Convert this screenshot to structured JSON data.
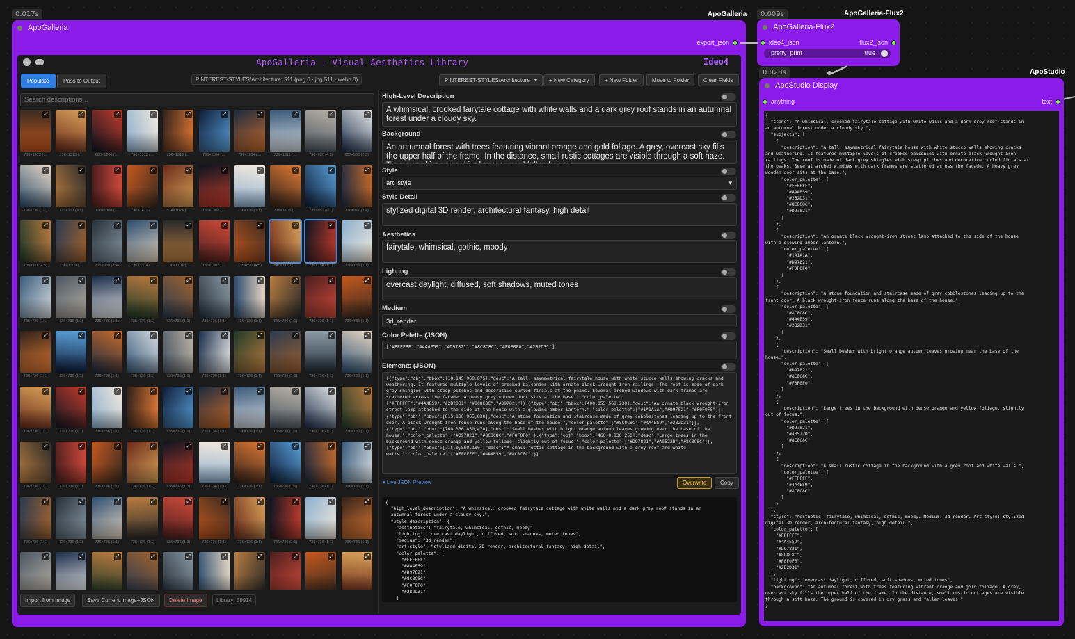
{
  "timings": {
    "galleria": "0.017s",
    "flux2": "0.009s",
    "studio": "0.023s"
  },
  "galleria": {
    "node_title": "ApoGalleria",
    "top_title": "ApoGalleria",
    "output_port": "export_json",
    "banner_title": "ApoGalleria - Visual Aesthetics Library",
    "banner_right": "Ideo4",
    "toolbar": {
      "populate": "Populate",
      "pass": "Pass to Output",
      "status": "PINTEREST-STYLES/Architecture: 511 (png 0 · jpg 511 · webp 0)",
      "folder_select": "PINTEREST-STYLES/Architecture",
      "new_category": "+ New Category",
      "new_folder": "+ New Folder",
      "move": "Move to Folder",
      "clear": "Clear Fields"
    },
    "search_placeholder": "Search descriptions...",
    "footer": {
      "import": "Import from Image",
      "save": "Save Current Image+JSON",
      "delete": "Delete Image",
      "library": "Library: 59914"
    },
    "captions": [
      [
        "736×1472 (…",
        "736×1313 (…",
        "600×1200 (…",
        "736×1312 (…",
        "736×1313 (…",
        "736×1104 (…",
        "736×1104 (…",
        "736×1311 (…",
        "736×920 (4:5)",
        "657×986 (2:3)"
      ],
      [
        "736×736 (1:1)",
        "735×917 (4:5)",
        "736×1308 (…",
        "736×1472 (…",
        "574×1024 (…",
        "736×1308 (…",
        "736×736 (1:1)",
        "736×1308 (…",
        "735×857 (6:7)",
        "736×977 (3:4)"
      ],
      [
        "736×911 (4:5)",
        "736×1309 (…",
        "715×988 (3:4)",
        "736×1314 (…",
        "736×1104 (…",
        "736×1307 (…",
        "735×896 (4:5)",
        "840×1120 (…",
        "736×754 (1:1)",
        "736×736 (1:1)"
      ],
      [
        "736×736 (1:1)",
        "736×736 (1:1)",
        "736×736 (1:1)",
        "736×736 (1:1)",
        "736×736 (1:1)",
        "736×736 (1:1)",
        "736×736 (1:1)",
        "736×736 (1:1)",
        "736×736 (1:1)",
        "736×736 (1:1)"
      ],
      [
        "736×736 (1:1)",
        "736×736 (1:1)",
        "736×736 (1:1)",
        "736×736 (1:1)",
        "736×736 (1:1)",
        "736×736 (1:1)",
        "736×736 (1:1)",
        "736×736 (1:1)",
        "736×736 (1:1)",
        "736×736 (1:1)"
      ],
      [
        "736×736 (1:1)",
        "736×736 (1:1)",
        "736×736 (1:1)",
        "736×736 (1:1)",
        "736×736 (1:1)",
        "736×736 (1:1)",
        "736×736 (1:1)",
        "736×736 (1:1)",
        "736×736 (1:1)",
        "736×736 (1:1)"
      ],
      [
        "736×736 (1:1)",
        "736×736 (1:1)",
        "736×736 (1:1)",
        "736×736 (1:1)",
        "736×736 (1:1)",
        "736×736 (1:1)",
        "736×736 (1:1)",
        "736×736 (1:1)",
        "736×736 (1:1)",
        "736×736 (1:1)"
      ],
      [
        "736×736 (1:1)",
        "736×736 (1:1)",
        "736×736 (1:1)",
        "736×736 (1:1)",
        "736×736 (1:1)",
        "736×736 (1:1)",
        "736×736 (1:1)",
        "736×736 (1:1)",
        "736×736 (1:1)",
        "736×736 (1:1)"
      ],
      [
        "",
        "",
        "",
        "",
        "",
        "",
        "",
        "",
        "",
        ""
      ]
    ],
    "fields": {
      "high_level_label": "High-Level Description",
      "high_level": "A whimsical, crooked fairytale cottage with white walls and a dark grey roof stands in an autumnal forest under a cloudy sky.",
      "background_label": "Background",
      "background": "An autumnal forest with trees featuring vibrant orange and gold foliage. A grey, overcast sky fills the upper half of the frame. In the distance, small rustic cottages are visible through a soft haze. The ground is covered in dry grass and fallen leaves.",
      "style_label": "Style",
      "style": "art_style",
      "style_detail_label": "Style Detail",
      "style_detail": "stylized digital 3D render, architectural fantasy, high detail",
      "aesthetics_label": "Aesthetics",
      "aesthetics": "fairytale, whimsical, gothic, moody",
      "lighting_label": "Lighting",
      "lighting": "overcast daylight, diffused, soft shadows, muted tones",
      "medium_label": "Medium",
      "medium": "3d_render",
      "palette_label": "Color Palette (JSON)",
      "palette": "[\"#FFFFFF\",\"#4A4E59\",\"#D97821\",\"#8C8C8C\",\"#F0F0F0\",\"#2B2D31\"]",
      "elements_label": "Elements (JSON)",
      "elements": "[{\"type\":\"obj\",\"bbox\":[10,145,960,875],\"desc\":\"A tall, asymmetrical fairytale house with white stucco walls showing cracks and weathering. It features multiple levels of crooked balconies with ornate black wrought-iron railings. The roof is made of dark grey shingles with steep pitches and decorative curled finials at the peaks. Several arched windows with dark frames are scattered across the facade. A heavy grey wooden door sits at the base.\",\"color_palette\":[\"#FFFFFF\",\"#4A4E59\",\"#2B2D31\",\"#8C8C8C\",\"#D97821\"]},{\"type\":\"obj\",\"bbox\":[400,155,560,230],\"desc\":\"An ornate black wrought-iron street lamp attached to the side of the house with a glowing amber lantern.\",\"color_palette\":[\"#1A1A1A\",\"#D97821\",\"#F0F0F0\"]},{\"type\":\"obj\",\"bbox\":[815,180,965,830],\"desc\":\"A stone foundation and staircase made of grey cobblestones leading up to the front door. A black wrought-iron fence runs along the base of the house.\",\"color_palette\":[\"#8C8C8C\",\"#4A4E59\",\"#2B2D31\"]},{\"type\":\"obj\",\"bbox\":[760,330,850,470],\"desc\":\"Small bushes with bright orange autumn leaves growing near the base of the house.\",\"color_palette\":[\"#D97821\",\"#8C8C8C\",\"#F0F0F0\"]},{\"type\":\"obj\",\"bbox\":[460,0,830,250],\"desc\":\"Large trees in the background with dense orange and yellow foliage, slightly out of focus.\",\"color_palette\":[\"#D97821\",\"#A0522D\",\"#8C8C8C\"]},{\"type\":\"obj\",\"bbox\":[715,0,860,180],\"desc\":\"A small rustic cottage in the background with a grey roof and white walls.\",\"color_palette\":[\"#FFFFFF\",\"#4A4E59\",\"#8C8C8C\"]}]",
      "live_preview": "▾ Live JSON Preview",
      "overwrite": "Overwrite",
      "copy": "Copy"
    },
    "preview_json": "{\n  \"high_level_description\": \"A whimsical, crooked fairytale cottage with white walls and a dark grey roof stands in an\n  autumnal forest under a cloudy sky.\",\n  \"style_description\": {\n    \"aesthetics\": \"fairytale, whimsical, gothic, moody\",\n    \"lighting\": \"overcast daylight, diffused, soft shadows, muted tones\",\n    \"medium\": \"3d_render\",\n    \"art_style\": \"stylized digital 3D render, architectural fantasy, high detail\",\n    \"color_palette\": [\n      \"#FFFFFF\",\n      \"#4A4E59\",\n      \"#D97821\",\n      \"#8C8C8C\",\n      \"#F0F0F0\",\n      \"#2B2D31\"\n    ]\n  },"
  },
  "flux2": {
    "top_title": "ApoGalleria-Flux2",
    "node_title": "ApoGalleria-Flux2",
    "input_port": "ideo4_json",
    "output_port": "flux2_json",
    "widget_label": "pretty_print",
    "widget_value": "true"
  },
  "studio": {
    "top_title": "ApoStudio",
    "node_title": "ApoStudio Display",
    "input_port": "anything",
    "output_port": "text",
    "text": "{\n  \"scene\": \"A whimsical, crooked fairytale cottage with white walls and a dark grey roof stands in\nan autumnal forest under a cloudy sky.\",\n  \"subjects\": [\n    {\n      \"description\": \"A tall, asymmetrical fairytale house with white stucco walls showing cracks\nand weathering. It features multiple levels of crooked balconies with ornate black wrought-iron\nrailings. The roof is made of dark grey shingles with steep pitches and decorative curled finials at\nthe peaks. Several arched windows with dark frames are scattered across the facade. A heavy grey\nwooden door sits at the base.\",\n      \"color_palette\": [\n        \"#FFFFFF\",\n        \"#4A4E59\",\n        \"#2B2D31\",\n        \"#8C8C8C\",\n        \"#D97821\"\n      ]\n    },\n    {\n      \"description\": \"An ornate black wrought-iron street lamp attached to the side of the house\nwith a glowing amber lantern.\",\n      \"color_palette\": [\n        \"#1A1A1A\",\n        \"#D97821\",\n        \"#F0F0F0\"\n      ]\n    },\n    {\n      \"description\": \"A stone foundation and staircase made of grey cobblestones leading up to the\nfront door. A black wrought-iron fence runs along the base of the house.\",\n      \"color_palette\": [\n        \"#8C8C8C\",\n        \"#4A4E59\",\n        \"#2B2D31\"\n      ]\n    },\n    {\n      \"description\": \"Small bushes with bright orange autumn leaves growing near the base of the\nhouse.\",\n      \"color_palette\": [\n        \"#D97821\",\n        \"#8C8C8C\",\n        \"#F0F0F0\"\n      ]\n    },\n    {\n      \"description\": \"Large trees in the background with dense orange and yellow foliage, slightly\nout of focus.\",\n      \"color_palette\": [\n        \"#D97821\",\n        \"#A0522D\",\n        \"#8C8C8C\"\n      ]\n    },\n    {\n      \"description\": \"A small rustic cottage in the background with a grey roof and white walls.\",\n      \"color_palette\": [\n        \"#FFFFFF\",\n        \"#4A4E59\",\n        \"#8C8C8C\"\n      ]\n    }\n  ],\n  \"style\": \"Aesthetic: fairytale, whimsical, gothic, moody. Medium: 3d_render. Art style: stylized\ndigital 3D render, architectural fantasy, high detail.\",\n  \"color_palette\": [\n    \"#FFFFFF\",\n    \"#4A4E59\",\n    \"#D97821\",\n    \"#8C8C8C\",\n    \"#F0F0F0\",\n    \"#2B2D31\"\n  ],\n  \"lighting\": \"overcast daylight, diffused, soft shadows, muted tones\",\n  \"background\": \"An autumnal forest with trees featuring vibrant orange and gold foliage. A grey,\novercast sky fills the upper half of the frame. In the distance, small rustic cottages are visible\nthrough a soft haze. The ground is covered in dry grass and fallen leaves.\"\n}"
  },
  "colors": {
    "node": "#8a1be8",
    "accent": "#2f7de1",
    "panel": "#1b1b1b",
    "port": "#7df25e"
  }
}
